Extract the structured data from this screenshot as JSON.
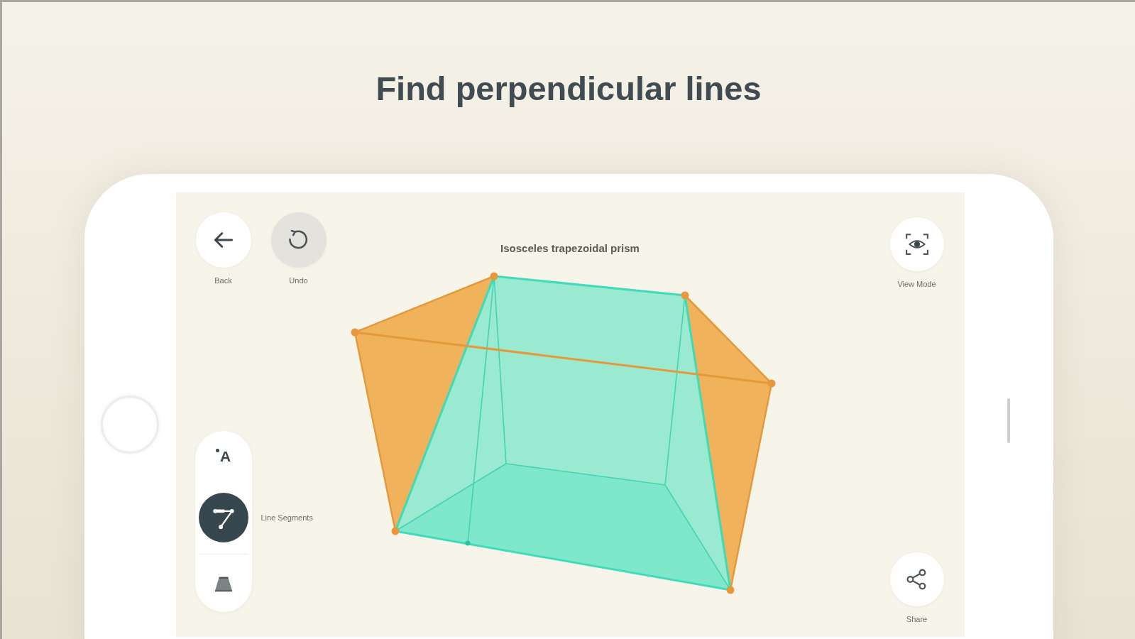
{
  "heading": "Find perpendicular lines",
  "screen": {
    "model_title": "Isosceles trapezoidal prism",
    "top_buttons": [
      {
        "kind": "back",
        "label": "Back",
        "disabled": false
      },
      {
        "kind": "undo",
        "label": "Undo",
        "disabled": true
      }
    ],
    "side_buttons": [
      {
        "kind": "view_mode",
        "label": "View Mode"
      },
      {
        "kind": "share",
        "label": "Share"
      }
    ],
    "tools": [
      {
        "kind": "label",
        "glyph": "A",
        "selected": false
      },
      {
        "kind": "line_segments",
        "label": "Line Segments",
        "selected": true
      },
      {
        "kind": "solid",
        "selected": false
      }
    ]
  }
}
